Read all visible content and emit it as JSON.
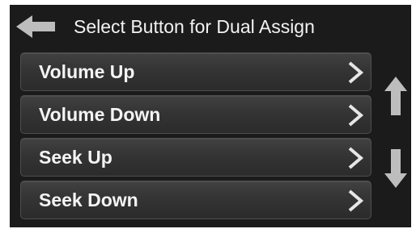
{
  "header": {
    "title": "Select Button for Dual Assign",
    "back_icon": "back-arrow-icon"
  },
  "menu": {
    "items": [
      {
        "label": "Volume Up",
        "icon": "chevron-right-icon"
      },
      {
        "label": "Volume Down",
        "icon": "chevron-right-icon"
      },
      {
        "label": "Seek Up",
        "icon": "chevron-right-icon"
      },
      {
        "label": "Seek Down",
        "icon": "chevron-right-icon"
      }
    ]
  },
  "scroll": {
    "up_icon": "arrow-up-icon",
    "down_icon": "arrow-down-icon"
  },
  "colors": {
    "background": "#1b1b1b",
    "button": "#363636",
    "text": "#f4f4f4",
    "icon": "#e6e6e6"
  }
}
